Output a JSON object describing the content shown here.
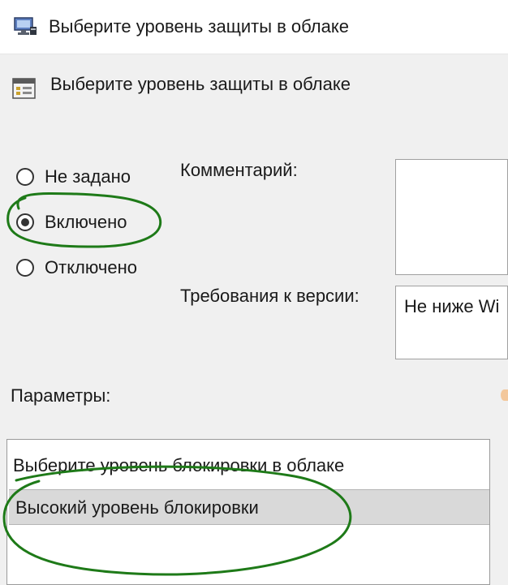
{
  "window": {
    "title": "Выберите уровень защиты в облаке",
    "icon": "computer-settings-icon"
  },
  "policy": {
    "title": "Выберите уровень защиты в облаке",
    "icon": "policy-settings-icon"
  },
  "state_options": [
    {
      "label": "Не задано",
      "checked": false
    },
    {
      "label": "Включено",
      "checked": true
    },
    {
      "label": "Отключено",
      "checked": false
    }
  ],
  "comment": {
    "label": "Комментарий:",
    "value": ""
  },
  "supported": {
    "label": "Требования к версии:",
    "value": "Не ниже Wi"
  },
  "parameters": {
    "label": "Параметры:",
    "setting_label": "Выберите уровень блокировки в облаке",
    "selected_value": "Высокий уровень блокировки"
  },
  "annotations": {
    "color": "#1e7a18"
  }
}
